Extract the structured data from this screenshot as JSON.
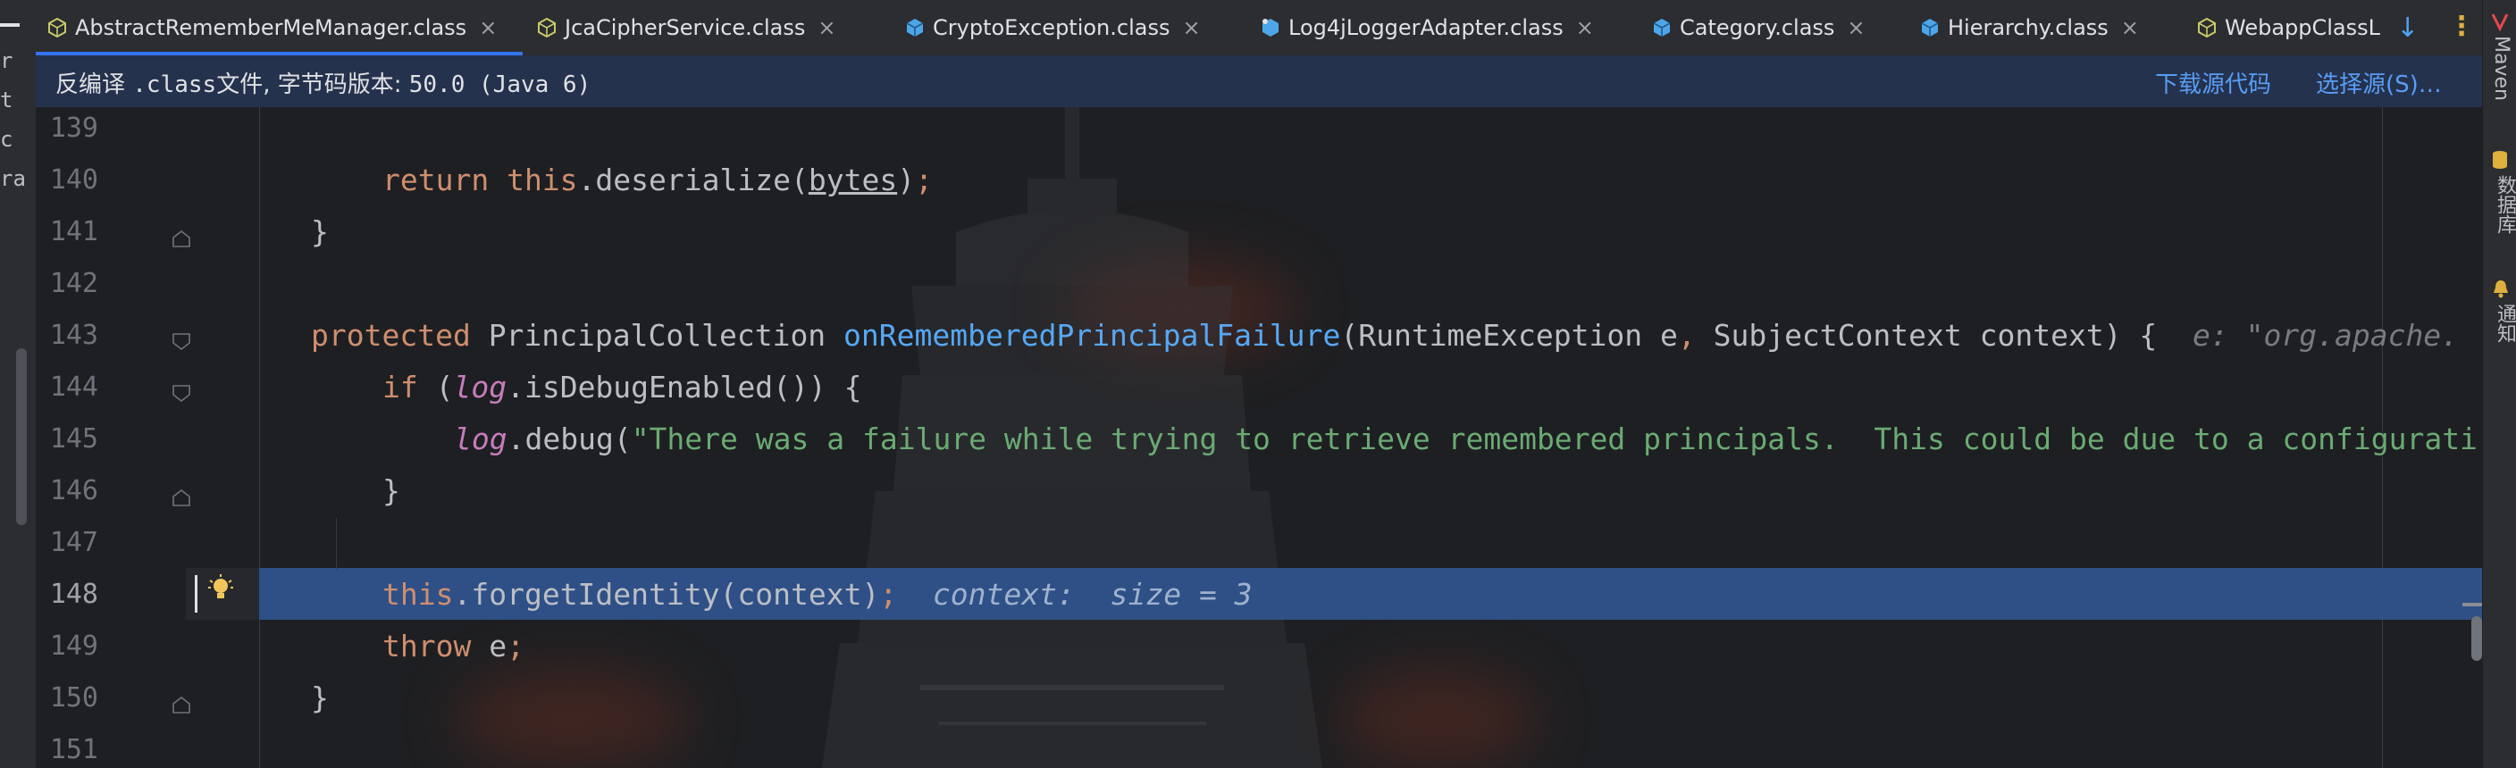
{
  "left_strip": {
    "chars": [
      "r",
      "t",
      "c",
      "ra"
    ]
  },
  "tabs": [
    {
      "label": "AbstractRememberMeManager.class",
      "close": "×",
      "icon": "class-file-icon",
      "active": true
    },
    {
      "label": "JcaCipherService.class",
      "close": "×",
      "icon": "class-file-icon"
    },
    {
      "label": "CryptoException.class",
      "close": "×",
      "icon": "class-file-icon"
    },
    {
      "label": "Log4jLoggerAdapter.class",
      "close": "×",
      "icon": "class-file-icon"
    },
    {
      "label": "Category.class",
      "close": "×",
      "icon": "class-file-icon"
    },
    {
      "label": "Hierarchy.class",
      "close": "×",
      "icon": "class-file-icon"
    },
    {
      "label": "WebappClassL",
      "close": "",
      "icon": "class-file-icon"
    }
  ],
  "tab_actions": {
    "recent": "↓",
    "more": "⋮"
  },
  "banner": {
    "text_prefix": "反编译 ",
    "text_mono": ".class",
    "text_middle": "文件, 字节码版本: ",
    "text_version": "50.0 (Java 6)",
    "download_link": "下载源代码",
    "choose_link": "选择源(S)…"
  },
  "editor": {
    "lines": [
      {
        "num": "139"
      },
      {
        "num": "140",
        "parts": [
          {
            "t": "return ",
            "c": "kw"
          },
          {
            "t": "this",
            "c": "kw"
          },
          {
            "t": ".deserialize(",
            "c": ""
          },
          {
            "t": "bytes",
            "c": "ul"
          },
          {
            "t": ")",
            "c": ""
          },
          {
            "t": ";",
            "c": "kw"
          }
        ],
        "indent": 2
      },
      {
        "num": "141",
        "parts": [
          {
            "t": "}",
            "c": ""
          }
        ],
        "indent": 1
      },
      {
        "num": "142"
      },
      {
        "num": "143",
        "parts": [
          {
            "t": "protected ",
            "c": "kw"
          },
          {
            "t": "PrincipalCollection ",
            "c": ""
          },
          {
            "t": "onRememberedPrincipalFailure",
            "c": "fn"
          },
          {
            "t": "(RuntimeException e",
            "c": ""
          },
          {
            "t": ", ",
            "c": "kw"
          },
          {
            "t": "SubjectContext context) {  ",
            "c": ""
          },
          {
            "t": "e: \"org.apache.",
            "c": "hint"
          }
        ],
        "indent": 1
      },
      {
        "num": "144",
        "parts": [
          {
            "t": "if ",
            "c": "kw"
          },
          {
            "t": "(",
            "c": ""
          },
          {
            "t": "log",
            "c": "fld"
          },
          {
            "t": ".isDebugEnabled()) {",
            "c": ""
          }
        ],
        "indent": 2
      },
      {
        "num": "145",
        "parts": [
          {
            "t": "log",
            "c": "fld"
          },
          {
            "t": ".debug(",
            "c": ""
          },
          {
            "t": "\"There was a failure while trying to retrieve remembered principals.  This could be due to a configurati",
            "c": "str"
          }
        ],
        "indent": 3
      },
      {
        "num": "146",
        "parts": [
          {
            "t": "}",
            "c": ""
          }
        ],
        "indent": 2
      },
      {
        "num": "147"
      },
      {
        "num": "148",
        "parts": [
          {
            "t": "this",
            "c": "kw"
          },
          {
            "t": ".forgetIdentity(context)",
            "c": ""
          },
          {
            "t": ";",
            "c": "kw"
          },
          {
            "t": "  context:  size = 3",
            "c": "hint-sel"
          }
        ],
        "indent": 2,
        "current": true
      },
      {
        "num": "149",
        "parts": [
          {
            "t": "throw ",
            "c": "kw"
          },
          {
            "t": "e",
            "c": ""
          },
          {
            "t": ";",
            "c": "kw"
          }
        ],
        "indent": 2
      },
      {
        "num": "150",
        "parts": [
          {
            "t": "}",
            "c": ""
          }
        ],
        "indent": 1
      },
      {
        "num": "151"
      }
    ]
  },
  "right_strip": {
    "maven": "Maven",
    "database": "数据库",
    "notifications": "通知"
  },
  "colors": {
    "accent": "#3574f0",
    "selection": "#2e5087",
    "keyword": "#cf8e6d",
    "function": "#56a8f5",
    "string": "#6aab73",
    "field": "#c77dbb",
    "link": "#589df6"
  }
}
